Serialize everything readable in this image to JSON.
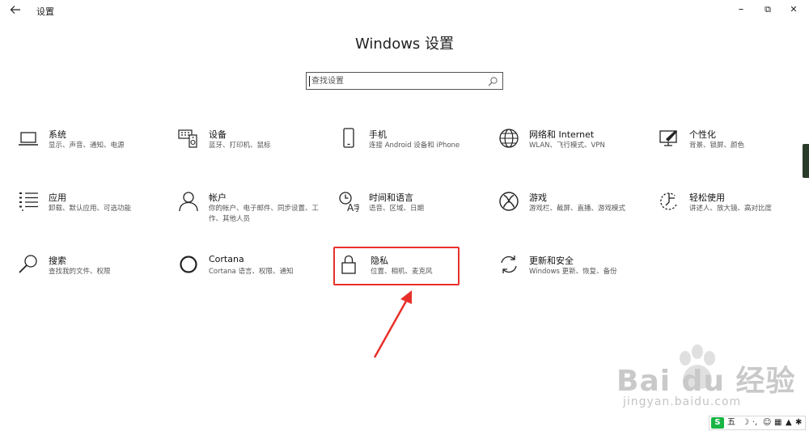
{
  "window": {
    "back_icon": "back-arrow-icon",
    "title": "设置",
    "min_glyph": "–",
    "max_glyph": "⧉",
    "close_glyph": "✕"
  },
  "heading": "Windows 设置",
  "search": {
    "placeholder": "查找设置",
    "icon": "search-icon"
  },
  "categories": [
    {
      "title": "系统",
      "desc": "显示、声音、通知、电源",
      "icon": "laptop-icon"
    },
    {
      "title": "设备",
      "desc": "蓝牙、打印机、鼠标",
      "icon": "keyboard-speaker-icon"
    },
    {
      "title": "手机",
      "desc": "连接 Android 设备和 iPhone",
      "icon": "phone-icon"
    },
    {
      "title": "网络和 Internet",
      "desc": "WLAN、飞行模式、VPN",
      "icon": "globe-icon"
    },
    {
      "title": "个性化",
      "desc": "背景、锁屏、颜色",
      "icon": "paint-monitor-icon"
    },
    {
      "title": "应用",
      "desc": "卸载、默认应用、可选功能",
      "icon": "app-list-icon"
    },
    {
      "title": "帐户",
      "desc": "你的帐户、电子邮件、同步设置、工作、其他人员",
      "icon": "person-icon"
    },
    {
      "title": "时间和语言",
      "desc": "语音、区域、日期",
      "icon": "time-language-icon"
    },
    {
      "title": "游戏",
      "desc": "游戏栏、截屏、直播、游戏模式",
      "icon": "xbox-icon"
    },
    {
      "title": "轻松使用",
      "desc": "讲述人、放大镜、高对比度",
      "icon": "ease-of-access-icon"
    },
    {
      "title": "搜索",
      "desc": "查找我的文件、权限",
      "icon": "magnifier-icon"
    },
    {
      "title": "Cortana",
      "desc": "Cortana 语言、权限、通知",
      "icon": "cortana-ring-icon"
    },
    {
      "title": "隐私",
      "desc": "位置、相机、麦克风",
      "icon": "lock-icon"
    },
    {
      "title": "更新和安全",
      "desc": "Windows 更新、恢复、备份",
      "icon": "sync-arrows-icon"
    }
  ],
  "annotation": {
    "color": "#e8302a",
    "highlight_index": 12
  },
  "watermark": {
    "line1": "Bai du 经验",
    "line2": "jingyan.baidu.com"
  },
  "ime": {
    "logo": "S",
    "mode": "五",
    "glyphs": [
      "☽",
      "·,",
      "☺",
      "▦",
      "▲",
      "✱"
    ]
  }
}
